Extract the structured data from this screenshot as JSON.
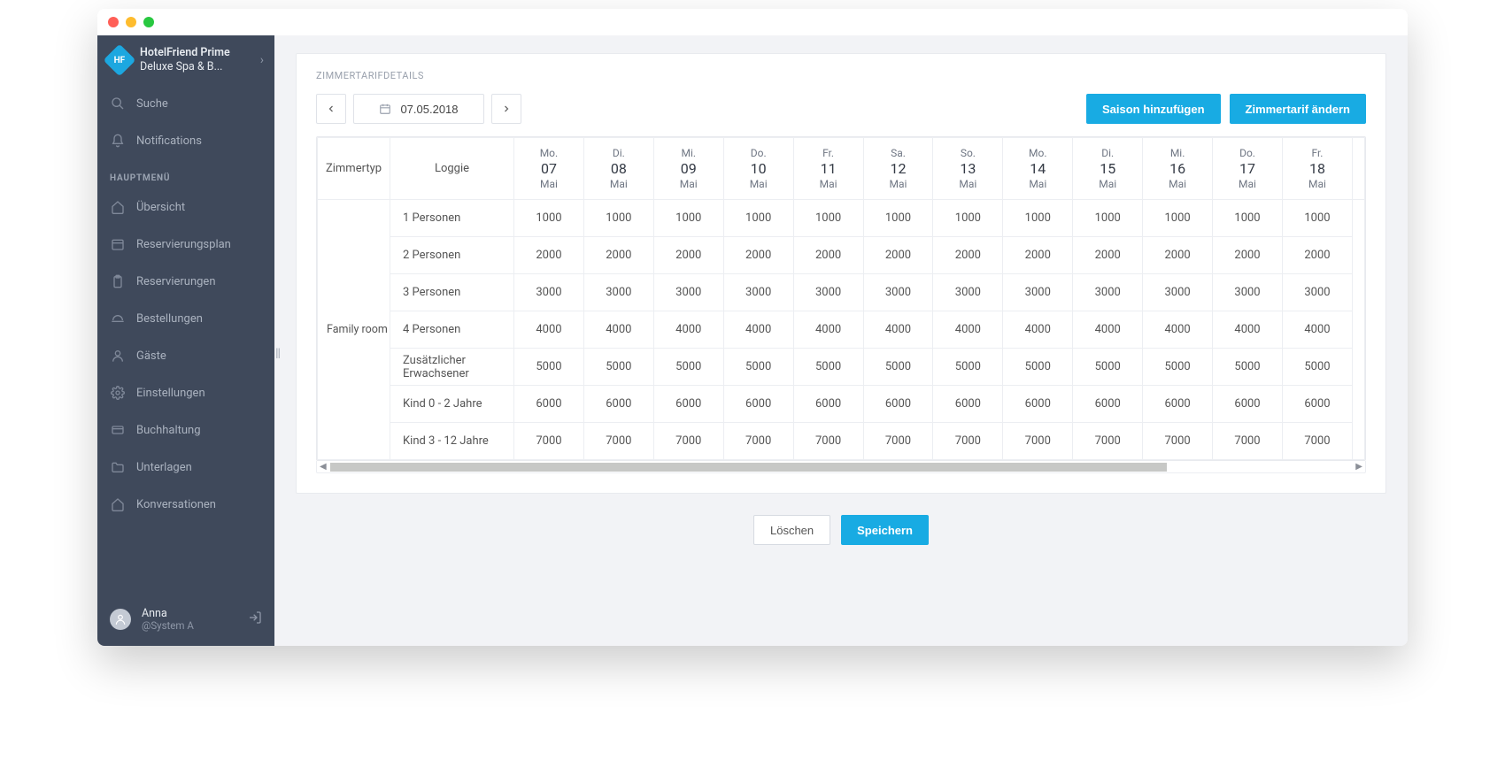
{
  "window": {
    "dots": {
      "close": "#ff5f57",
      "min": "#febc2e",
      "max": "#28c840"
    }
  },
  "brand": {
    "logo_text": "HF",
    "line1": "HotelFriend Prime",
    "line2": "Deluxe Spa & B..."
  },
  "sidebar": {
    "search": "Suche",
    "notifications": "Notifications",
    "section": "HAUPTMENÜ",
    "items": [
      "Übersicht",
      "Reservierungsplan",
      "Reservierungen",
      "Bestellungen",
      "Gäste",
      "Einstellungen",
      "Buchhaltung",
      "Unterlagen",
      "Konversationen"
    ]
  },
  "user": {
    "name": "Anna",
    "role": "@System A"
  },
  "card": {
    "title": "ZIMMERTARIFDETAILS",
    "date": "07.05.2018",
    "add_season": "Saison hinzufügen",
    "change_rate": "Zimmertarif ändern"
  },
  "table": {
    "header_zimmertyp": "Zimmertyp",
    "header_loggie": "Loggie",
    "room_type": "Family room",
    "days": [
      {
        "wd": "Mo.",
        "dn": "07",
        "mn": "Mai"
      },
      {
        "wd": "Di.",
        "dn": "08",
        "mn": "Mai"
      },
      {
        "wd": "Mi.",
        "dn": "09",
        "mn": "Mai"
      },
      {
        "wd": "Do.",
        "dn": "10",
        "mn": "Mai"
      },
      {
        "wd": "Fr.",
        "dn": "11",
        "mn": "Mai"
      },
      {
        "wd": "Sa.",
        "dn": "12",
        "mn": "Mai"
      },
      {
        "wd": "So.",
        "dn": "13",
        "mn": "Mai"
      },
      {
        "wd": "Mo.",
        "dn": "14",
        "mn": "Mai"
      },
      {
        "wd": "Di.",
        "dn": "15",
        "mn": "Mai"
      },
      {
        "wd": "Mi.",
        "dn": "16",
        "mn": "Mai"
      },
      {
        "wd": "Do.",
        "dn": "17",
        "mn": "Mai"
      },
      {
        "wd": "Fr.",
        "dn": "18",
        "mn": "Mai"
      }
    ],
    "rows": [
      {
        "label": "1 Personen",
        "value": "1000"
      },
      {
        "label": "2 Personen",
        "value": "2000"
      },
      {
        "label": "3 Personen",
        "value": "3000"
      },
      {
        "label": "4 Personen",
        "value": "4000"
      },
      {
        "label": "Zusätzlicher Erwachsener",
        "value": "5000"
      },
      {
        "label": "Kind 0 - 2 Jahre",
        "value": "6000"
      },
      {
        "label": "Kind 3 - 12 Jahre",
        "value": "7000"
      }
    ]
  },
  "footer": {
    "delete": "Löschen",
    "save": "Speichern"
  }
}
